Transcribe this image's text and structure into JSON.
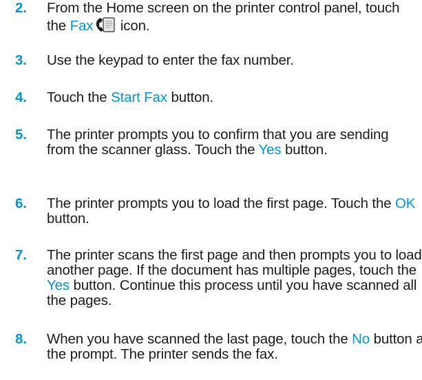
{
  "steps": [
    {
      "number": "2.",
      "parts": [
        {
          "text": "From the Home screen on the printer control panel, touch the "
        },
        {
          "text": "Fax",
          "link": true
        },
        {
          "icon": "fax-icon"
        },
        {
          "text": " icon."
        }
      ]
    },
    {
      "number": "3.",
      "parts": [
        {
          "text": "Use the keypad to enter the fax number."
        }
      ]
    },
    {
      "number": "4.",
      "parts": [
        {
          "text": "Touch the "
        },
        {
          "text": "Start Fax",
          "link": true
        },
        {
          "text": " button."
        }
      ]
    },
    {
      "number": "5.",
      "parts": [
        {
          "text": "The printer prompts you to confirm that you are sending from the scanner glass. Touch the "
        },
        {
          "text": "Yes",
          "link": true
        },
        {
          "text": " button."
        }
      ]
    },
    {
      "number": "6.",
      "parts": [
        {
          "text": "The printer prompts you to load the first page. Touch the "
        },
        {
          "text": "OK",
          "link": true
        },
        {
          "text": " button."
        }
      ]
    },
    {
      "number": "7.",
      "parts": [
        {
          "text": "The printer scans the first page and then prompts you to load another page. If the document has multiple pages, touch the "
        },
        {
          "text": "Yes",
          "link": true
        },
        {
          "text": " button. Continue this process until you have scanned all the pages."
        }
      ]
    },
    {
      "number": "8.",
      "parts": [
        {
          "text": "When you have scanned the last page, touch the "
        },
        {
          "text": "No",
          "link": true
        },
        {
          "text": " button at the prompt. The printer sends the fax."
        }
      ]
    }
  ],
  "colors": {
    "accent": "#0096d6",
    "text": "#1a1a1a"
  }
}
